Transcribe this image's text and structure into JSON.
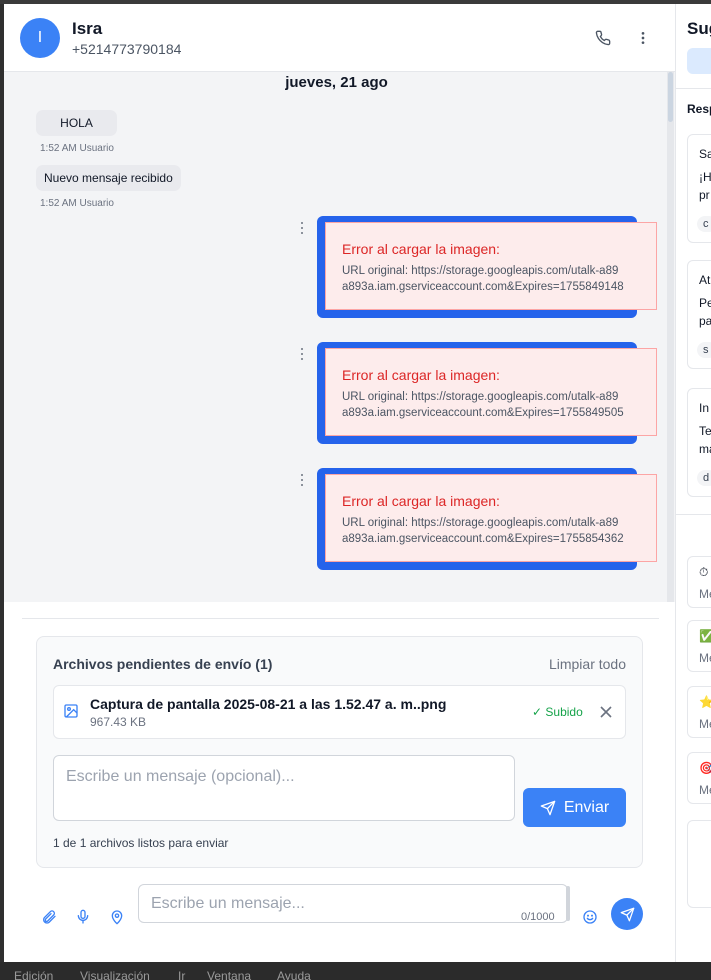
{
  "contact": {
    "initial": "I",
    "name": "Isra",
    "phone": "+5214773790184"
  },
  "header_icons": {
    "call": "phone-icon",
    "more": "more-vertical-icon"
  },
  "conversation": {
    "date": "jueves, 21 ago",
    "incoming": [
      {
        "text": "HOLA",
        "time": "1:52 AM",
        "sender": "Usuario"
      },
      {
        "text": "Nuevo mensaje recibido",
        "time": "1:52 AM",
        "sender": "Usuario"
      }
    ],
    "image_errors": [
      {
        "title": "Error al cargar la imagen:",
        "line1": "URL original: https://storage.googleapis.com/utalk-a89",
        "line2": "a893a.iam.gserviceaccount.com&Expires=1755849148"
      },
      {
        "title": "Error al cargar la imagen:",
        "line1": "URL original: https://storage.googleapis.com/utalk-a89",
        "line2": "a893a.iam.gserviceaccount.com&Expires=1755849505"
      },
      {
        "title": "Error al cargar la imagen:",
        "line1": "URL original: https://storage.googleapis.com/utalk-a89",
        "line2": "a893a.iam.gserviceaccount.com&Expires=1755854362"
      }
    ]
  },
  "pending": {
    "title": "Archivos pendientes de envío (1)",
    "clear_all": "Limpiar todo",
    "file": {
      "name": "Captura de pantalla 2025-08-21 a las 1.52.47 a. m..png",
      "size": "967.43 KB",
      "status": "✓ Subido"
    },
    "message_placeholder": "Escribe un mensaje (opcional)...",
    "send_label": "Enviar",
    "ready_count": "1 de 1 archivos listos para enviar"
  },
  "composer": {
    "placeholder": "Escribe un mensaje...",
    "char_count": "0/1000",
    "icons": [
      "paperclip-icon",
      "microphone-icon",
      "location-pin-icon",
      "emoji-icon",
      "send-icon"
    ]
  },
  "sidebar": {
    "title": "Sug",
    "subtitle": "Resp",
    "cards": [
      {
        "title": "Sa",
        "line1": "¡H",
        "line2": "pr",
        "tag": "c"
      },
      {
        "title": "At",
        "line1": "Pe",
        "line2": "pa",
        "tag": "s"
      },
      {
        "title": "In",
        "line1": "Te",
        "line2": "ma",
        "tag": "d"
      }
    ],
    "quick": [
      {
        "emoji": "⏱",
        "text": "Me"
      },
      {
        "emoji": "✅",
        "text": "Me"
      },
      {
        "emoji": "⭐",
        "text": "Me"
      },
      {
        "emoji": "🎯",
        "text": "Me"
      }
    ]
  },
  "os_menu": [
    "Edición",
    "Visualización",
    "Ir",
    "Ventana",
    "Ayuda"
  ],
  "colors": {
    "accent": "#3b82f6",
    "error_text": "#dc2626",
    "success": "#16a34a"
  }
}
